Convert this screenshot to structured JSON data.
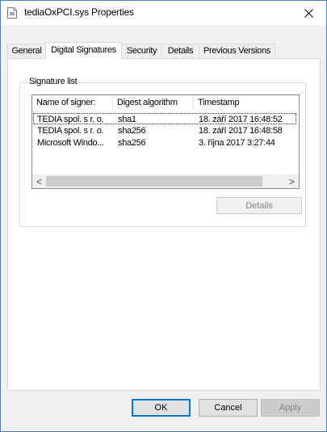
{
  "window": {
    "title": "tediaOxPCI.sys Properties",
    "close_symbol": "✕"
  },
  "tabs": [
    {
      "label": "General",
      "active": false
    },
    {
      "label": "Digital Signatures",
      "active": true
    },
    {
      "label": "Security",
      "active": false
    },
    {
      "label": "Details",
      "active": false
    },
    {
      "label": "Previous Versions",
      "active": false
    }
  ],
  "signature_list": {
    "group_label": "Signature list",
    "columns": [
      "Name of signer:",
      "Digest algorithm",
      "Timestamp"
    ],
    "rows": [
      {
        "name": "TEDIA spol. s r. o.",
        "digest": "sha1",
        "timestamp": "18. září 2017 16:48:52",
        "selected": true
      },
      {
        "name": "TEDIA spol. s r. o.",
        "digest": "sha256",
        "timestamp": "18. září 2017 16:48:58",
        "selected": false
      },
      {
        "name": "Microsoft Windo...",
        "digest": "sha256",
        "timestamp": "3. října 2017 3:27:44",
        "selected": false
      }
    ],
    "scroll_left": "<",
    "scroll_right": ">",
    "details_button": "Details"
  },
  "buttons": {
    "ok": "OK",
    "cancel": "Cancel",
    "apply": "Apply"
  }
}
